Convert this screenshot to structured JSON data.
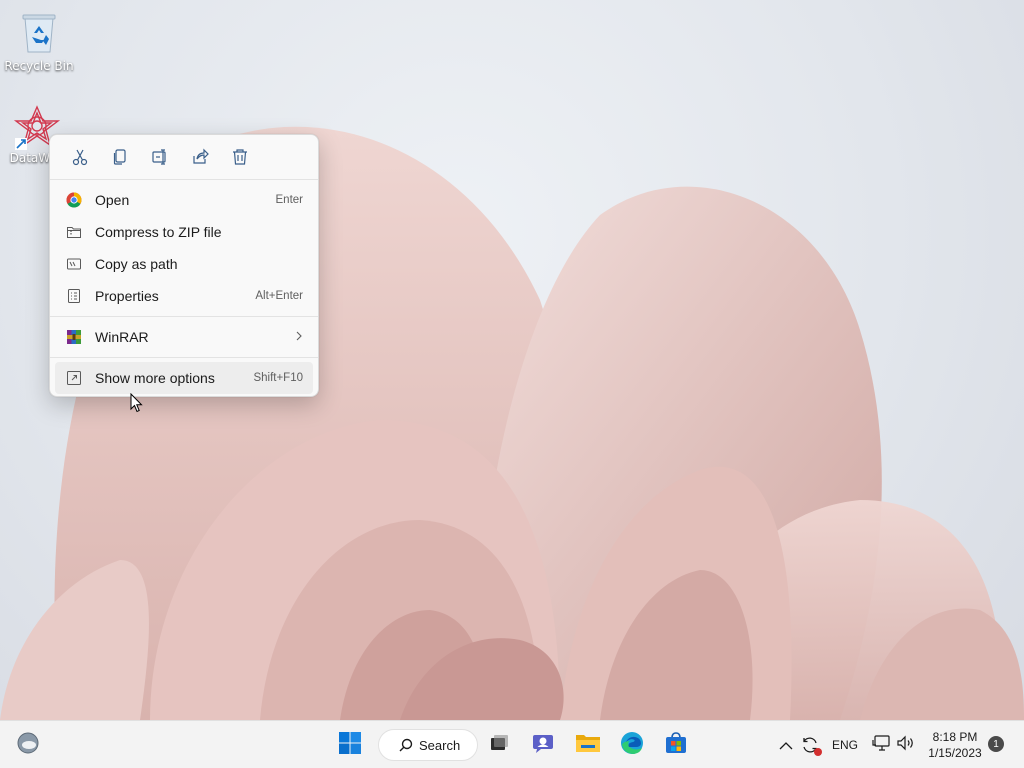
{
  "desktop": {
    "icons": [
      {
        "label": "Recycle Bin",
        "icon": "recycle-bin-icon"
      },
      {
        "label": "DataWag",
        "icon": "datawagon-app-icon"
      }
    ]
  },
  "context_menu": {
    "quick_actions": [
      {
        "name": "cut",
        "icon": "scissors-icon"
      },
      {
        "name": "copy",
        "icon": "copy-icon"
      },
      {
        "name": "rename",
        "icon": "rename-icon"
      },
      {
        "name": "share",
        "icon": "share-icon"
      },
      {
        "name": "delete",
        "icon": "trash-icon"
      }
    ],
    "items": [
      {
        "label": "Open",
        "shortcut": "Enter",
        "icon": "chrome-icon"
      },
      {
        "label": "Compress to ZIP file",
        "shortcut": "",
        "icon": "zip-folder-icon"
      },
      {
        "label": "Copy as path",
        "shortcut": "",
        "icon": "copy-path-icon"
      },
      {
        "label": "Properties",
        "shortcut": "Alt+Enter",
        "icon": "properties-icon"
      },
      {
        "label": "WinRAR",
        "shortcut": "",
        "icon": "winrar-icon",
        "submenu": true
      },
      {
        "label": "Show more options",
        "shortcut": "Shift+F10",
        "icon": "more-options-icon",
        "hovered": true
      }
    ]
  },
  "taskbar": {
    "search_label": "Search",
    "language": "ENG",
    "time": "8:18 PM",
    "date": "1/15/2023",
    "notification_count": "1",
    "accent": "#0067c0"
  }
}
